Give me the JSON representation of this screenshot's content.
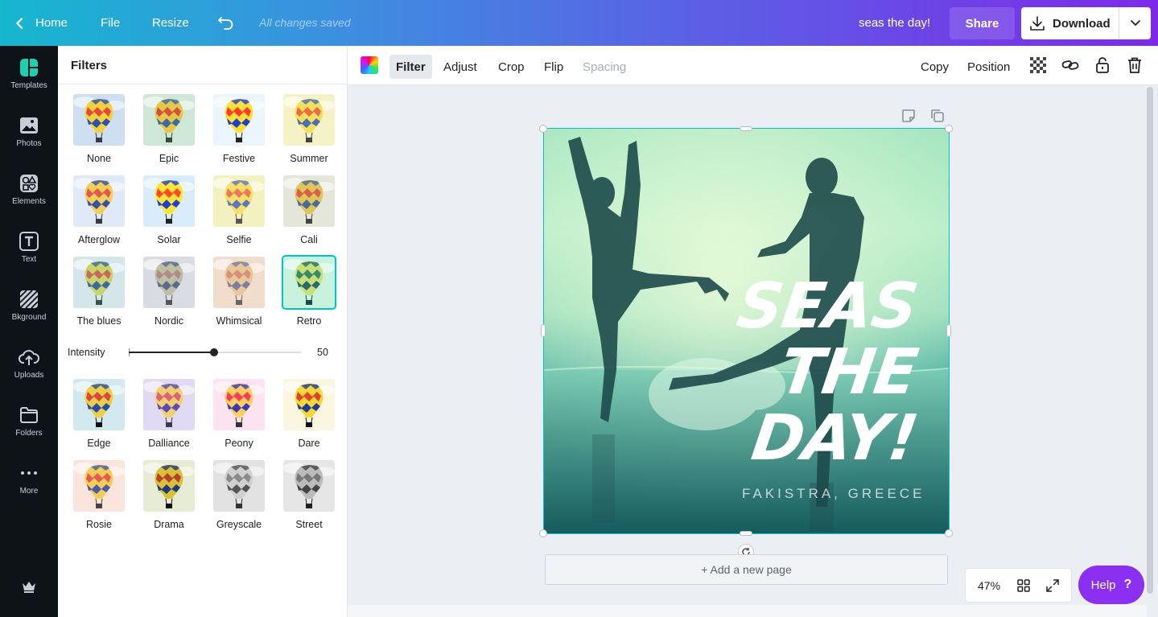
{
  "topbar": {
    "home": "Home",
    "file": "File",
    "resize": "Resize",
    "saved_status": "All changes saved",
    "doc_name": "seas the day!",
    "share": "Share",
    "download": "Download"
  },
  "rail": {
    "items": [
      {
        "label": "Templates",
        "icon": "templates-icon"
      },
      {
        "label": "Photos",
        "icon": "photos-icon"
      },
      {
        "label": "Elements",
        "icon": "elements-icon"
      },
      {
        "label": "Text",
        "icon": "text-icon"
      },
      {
        "label": "Bkground",
        "icon": "background-icon"
      },
      {
        "label": "Uploads",
        "icon": "uploads-icon"
      },
      {
        "label": "Folders",
        "icon": "folders-icon"
      },
      {
        "label": "More",
        "icon": "more-icon"
      }
    ]
  },
  "panel": {
    "title": "Filters",
    "filters": [
      {
        "label": "None",
        "bg": "#cfdff2",
        "tint": "none"
      },
      {
        "label": "Epic",
        "bg": "#cfe7d6",
        "tint": "epic"
      },
      {
        "label": "Festive",
        "bg": "#eaf5ff",
        "tint": "festive"
      },
      {
        "label": "Summer",
        "bg": "#f5f3c6",
        "tint": "summer"
      },
      {
        "label": "Afterglow",
        "bg": "#dfe9f7",
        "tint": "afterglow"
      },
      {
        "label": "Solar",
        "bg": "#d8ecfb",
        "tint": "solar"
      },
      {
        "label": "Selfie",
        "bg": "#f4f1c0",
        "tint": "selfie"
      },
      {
        "label": "Cali",
        "bg": "#e3e6d8",
        "tint": "cali"
      },
      {
        "label": "The blues",
        "bg": "#d4e6ea",
        "tint": "blues"
      },
      {
        "label": "Nordic",
        "bg": "#d9dde3",
        "tint": "nordic"
      },
      {
        "label": "Whimsical",
        "bg": "#f2dccb",
        "tint": "whimsical"
      },
      {
        "label": "Retro",
        "bg": "#c9f2dc",
        "tint": "retro"
      },
      {
        "label": "Edge",
        "bg": "#d2e9ef",
        "tint": "edge"
      },
      {
        "label": "Dalliance",
        "bg": "#e1daf4",
        "tint": "dalliance"
      },
      {
        "label": "Peony",
        "bg": "#fde2f2",
        "tint": "peony"
      },
      {
        "label": "Dare",
        "bg": "#fbf6df",
        "tint": "dare"
      },
      {
        "label": "Rosie",
        "bg": "#fbe4dc",
        "tint": "rosie"
      },
      {
        "label": "Drama",
        "bg": "#e6ebd4",
        "tint": "drama"
      },
      {
        "label": "Greyscale",
        "bg": "#e2e2e2",
        "tint": "grey"
      },
      {
        "label": "Street",
        "bg": "#e6e6e6",
        "tint": "street"
      }
    ],
    "selected_filter": "Retro",
    "intensity_label": "Intensity",
    "intensity_value": "50",
    "intensity_fraction": 0.5
  },
  "toolbar": {
    "filter": "Filter",
    "adjust": "Adjust",
    "crop": "Crop",
    "flip": "Flip",
    "spacing": "Spacing",
    "copy": "Copy",
    "position": "Position"
  },
  "canvas": {
    "headline_1": "SEAS",
    "headline_2": "THE",
    "headline_3": "DAY!",
    "subline": "FAKISTRA, GREECE",
    "add_page": "+ Add a new page"
  },
  "footer": {
    "zoom": "47%",
    "help": "Help",
    "help_mark": "?"
  },
  "colors": {
    "accent": "#00c4cc",
    "brand_purple": "#7d2ae8",
    "help_purple": "#8b2ff0"
  }
}
